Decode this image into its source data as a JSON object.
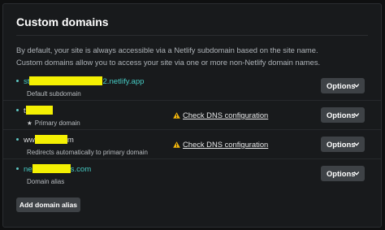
{
  "card": {
    "title": "Custom domains",
    "description_line1": "By default, your site is always accessible via a Netlify subdomain based on the site name.",
    "description_line2": "Custom domains allow you to access your site via one or more non-Netlify domain names."
  },
  "domains": [
    {
      "name_prefix": "st",
      "name_suffix": "2.netlify.app",
      "subtitle": "Default subdomain",
      "options_label": "Options"
    },
    {
      "name_prefix": "t",
      "name_suffix": "",
      "subtitle": "Primary domain",
      "subtitle_icon": "star-icon",
      "dns_check_label": "Check DNS configuration",
      "options_label": "Options"
    },
    {
      "name_prefix": "ww",
      "name_suffix": "m",
      "subtitle": "Redirects automatically to primary domain",
      "dns_check_label": "Check DNS configuration",
      "options_label": "Options"
    },
    {
      "name_prefix": "ne",
      "name_suffix": "s.com",
      "subtitle": "Domain alias",
      "options_label": "Options"
    }
  ],
  "add_domain_label": "Add domain alias",
  "colors": {
    "background": "#0f1011",
    "card": "#181a1c",
    "link_teal": "#46c9c2",
    "redaction": "#f4f003",
    "warning": "#f5b80b",
    "button": "#3e4246"
  }
}
